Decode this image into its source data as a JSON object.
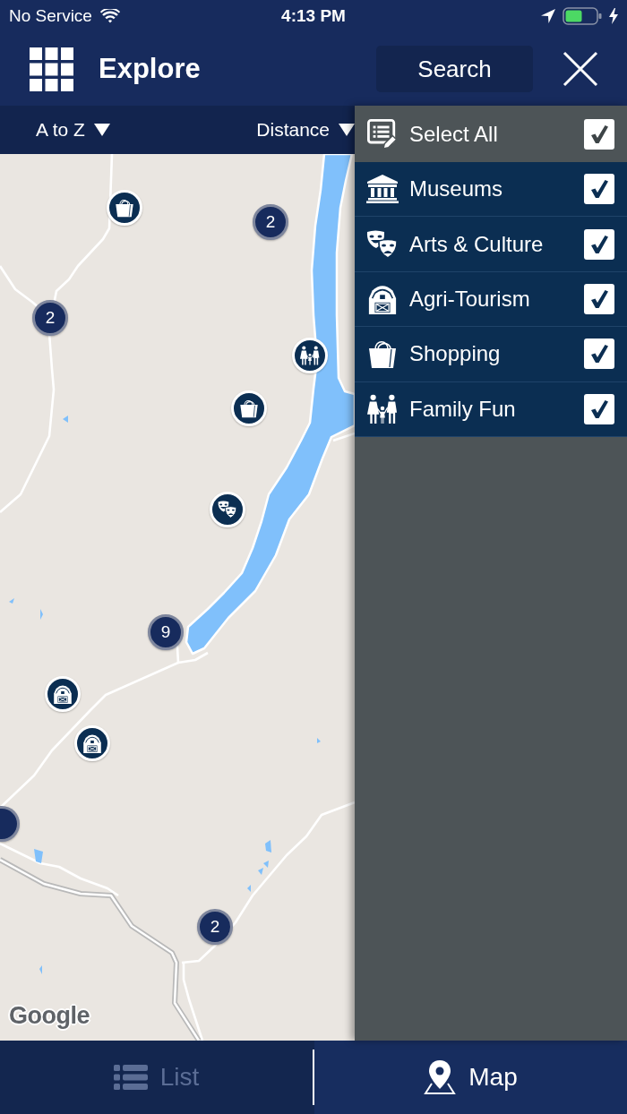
{
  "status_bar": {
    "carrier": "No Service",
    "time": "4:13 PM"
  },
  "header": {
    "title": "Explore",
    "search_button": "Search"
  },
  "sort_bar": [
    {
      "label": "A to Z"
    },
    {
      "label": "Distance"
    }
  ],
  "map": {
    "markers": [
      {
        "kind": "shopping"
      },
      {
        "kind": "cluster",
        "count": "2"
      },
      {
        "kind": "cluster",
        "count": "2"
      },
      {
        "kind": "family"
      },
      {
        "kind": "shopping"
      },
      {
        "kind": "arts"
      },
      {
        "kind": "cluster",
        "count": "9"
      },
      {
        "kind": "farm"
      },
      {
        "kind": "farm"
      },
      {
        "kind": "cluster"
      },
      {
        "kind": "cluster",
        "count": "2"
      }
    ],
    "attribution": "Google"
  },
  "filter_panel": {
    "items": [
      {
        "kind": "all",
        "label": "Select All",
        "checked": true
      },
      {
        "kind": "museum",
        "label": "Museums",
        "checked": true
      },
      {
        "kind": "arts",
        "label": "Arts & Culture",
        "checked": true
      },
      {
        "kind": "farm",
        "label": "Agri-Tourism",
        "checked": true
      },
      {
        "kind": "shopping",
        "label": "Shopping",
        "checked": true
      },
      {
        "kind": "family",
        "label": "Family Fun",
        "checked": true
      }
    ]
  },
  "bottom_tabs": [
    {
      "kind": "list",
      "label": "List",
      "selected": false
    },
    {
      "kind": "map",
      "label": "Map",
      "selected": true
    }
  ]
}
